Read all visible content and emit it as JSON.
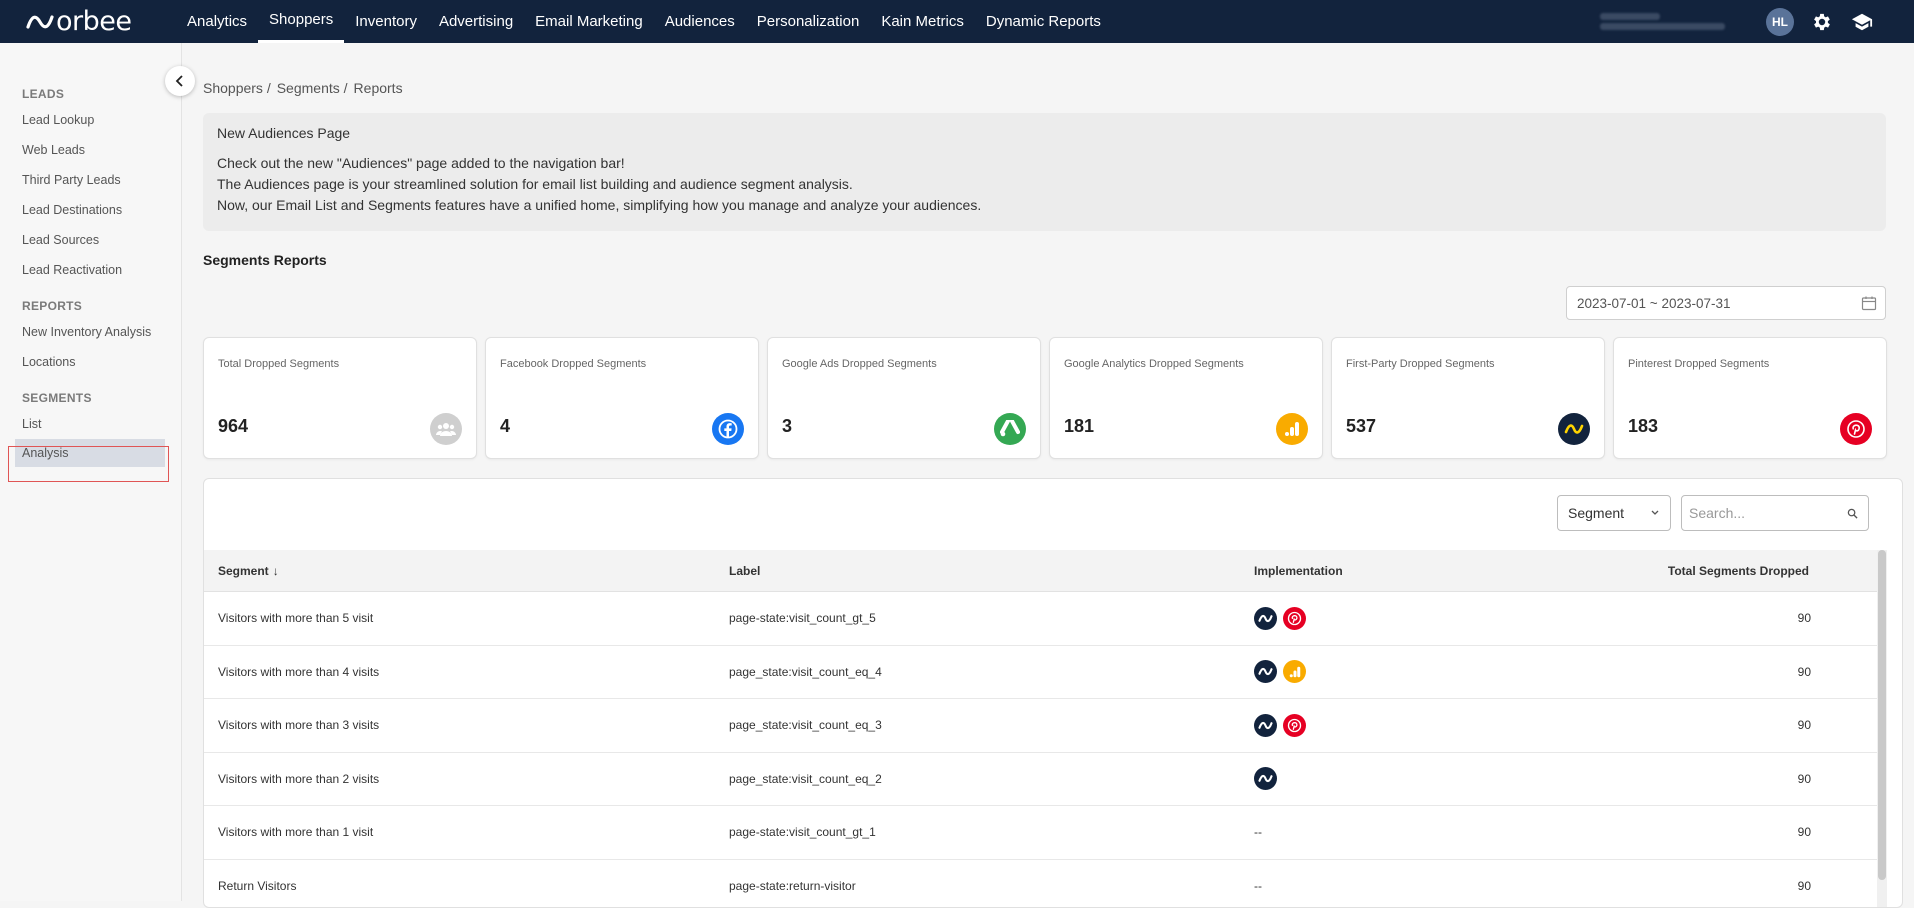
{
  "brand": {
    "name": "orbee"
  },
  "nav": {
    "items": [
      "Analytics",
      "Shoppers",
      "Inventory",
      "Advertising",
      "Email Marketing",
      "Audiences",
      "Personalization",
      "Kain Metrics",
      "Dynamic Reports"
    ],
    "active": "Shoppers",
    "avatar_initials": "HL"
  },
  "sidebar": {
    "sections": [
      {
        "heading": "LEADS",
        "items": [
          "Lead Lookup",
          "Web Leads",
          "Third Party Leads",
          "Lead Destinations",
          "Lead Sources",
          "Lead Reactivation"
        ]
      },
      {
        "heading": "REPORTS",
        "items": [
          "New Inventory Analysis",
          "Locations"
        ]
      },
      {
        "heading": "SEGMENTS",
        "items": [
          "List",
          "Analysis"
        ]
      }
    ],
    "active_item": "Analysis"
  },
  "breadcrumb": [
    "Shoppers",
    "Segments",
    "Reports"
  ],
  "notice": {
    "title": "New Audiences Page",
    "lines": [
      "Check out the new \"Audiences\" page added to the navigation bar!",
      "The Audiences page is your streamlined solution for email list building and audience segment analysis.",
      "Now, our Email List and Segments features have a unified home, simplifying how you manage and analyze your audiences."
    ]
  },
  "section_title": "Segments Reports",
  "date_range": "2023-07-01 ~ 2023-07-31",
  "cards": [
    {
      "label": "Total Dropped Segments",
      "value": "964",
      "icon": "people-icon",
      "color": "#cfcfcf"
    },
    {
      "label": "Facebook Dropped Segments",
      "value": "4",
      "icon": "facebook-icon",
      "color": "#1877f2"
    },
    {
      "label": "Google Ads Dropped Segments",
      "value": "3",
      "icon": "google-ads-icon",
      "color": "#34a853"
    },
    {
      "label": "Google Analytics Dropped Segments",
      "value": "181",
      "icon": "google-analytics-icon",
      "color": "#f9ab00"
    },
    {
      "label": "First-Party Dropped Segments",
      "value": "537",
      "icon": "first-party-icon",
      "color": "#12233d"
    },
    {
      "label": "Pinterest Dropped Segments",
      "value": "183",
      "icon": "pinterest-icon",
      "color": "#e60023"
    }
  ],
  "filters": {
    "select_value": "Segment",
    "search_placeholder": "Search..."
  },
  "table": {
    "headers": {
      "segment": "Segment",
      "label": "Label",
      "implementation": "Implementation",
      "total": "Total Segments Dropped"
    },
    "rows": [
      {
        "segment": "Visitors with more than 5 visit",
        "label": "page-state:visit_count_gt_5",
        "impl": [
          "first-party",
          "pinterest"
        ],
        "total": "90"
      },
      {
        "segment": "Visitors with more than 4 visits",
        "label": "page_state:visit_count_eq_4",
        "impl": [
          "first-party",
          "google-analytics"
        ],
        "total": "90"
      },
      {
        "segment": "Visitors with more than 3 visits",
        "label": "page_state:visit_count_eq_3",
        "impl": [
          "first-party",
          "pinterest"
        ],
        "total": "90"
      },
      {
        "segment": "Visitors with more than 2 visits",
        "label": "page_state:visit_count_eq_2",
        "impl": [
          "first-party"
        ],
        "total": "90"
      },
      {
        "segment": "Visitors with more than 1 visit",
        "label": "page-state:visit_count_gt_1",
        "impl": [],
        "impl_empty": "--",
        "total": "90"
      },
      {
        "segment": "Return Visitors",
        "label": "page-state:return-visitor",
        "impl": [],
        "impl_empty": "--",
        "total": "90"
      }
    ]
  }
}
